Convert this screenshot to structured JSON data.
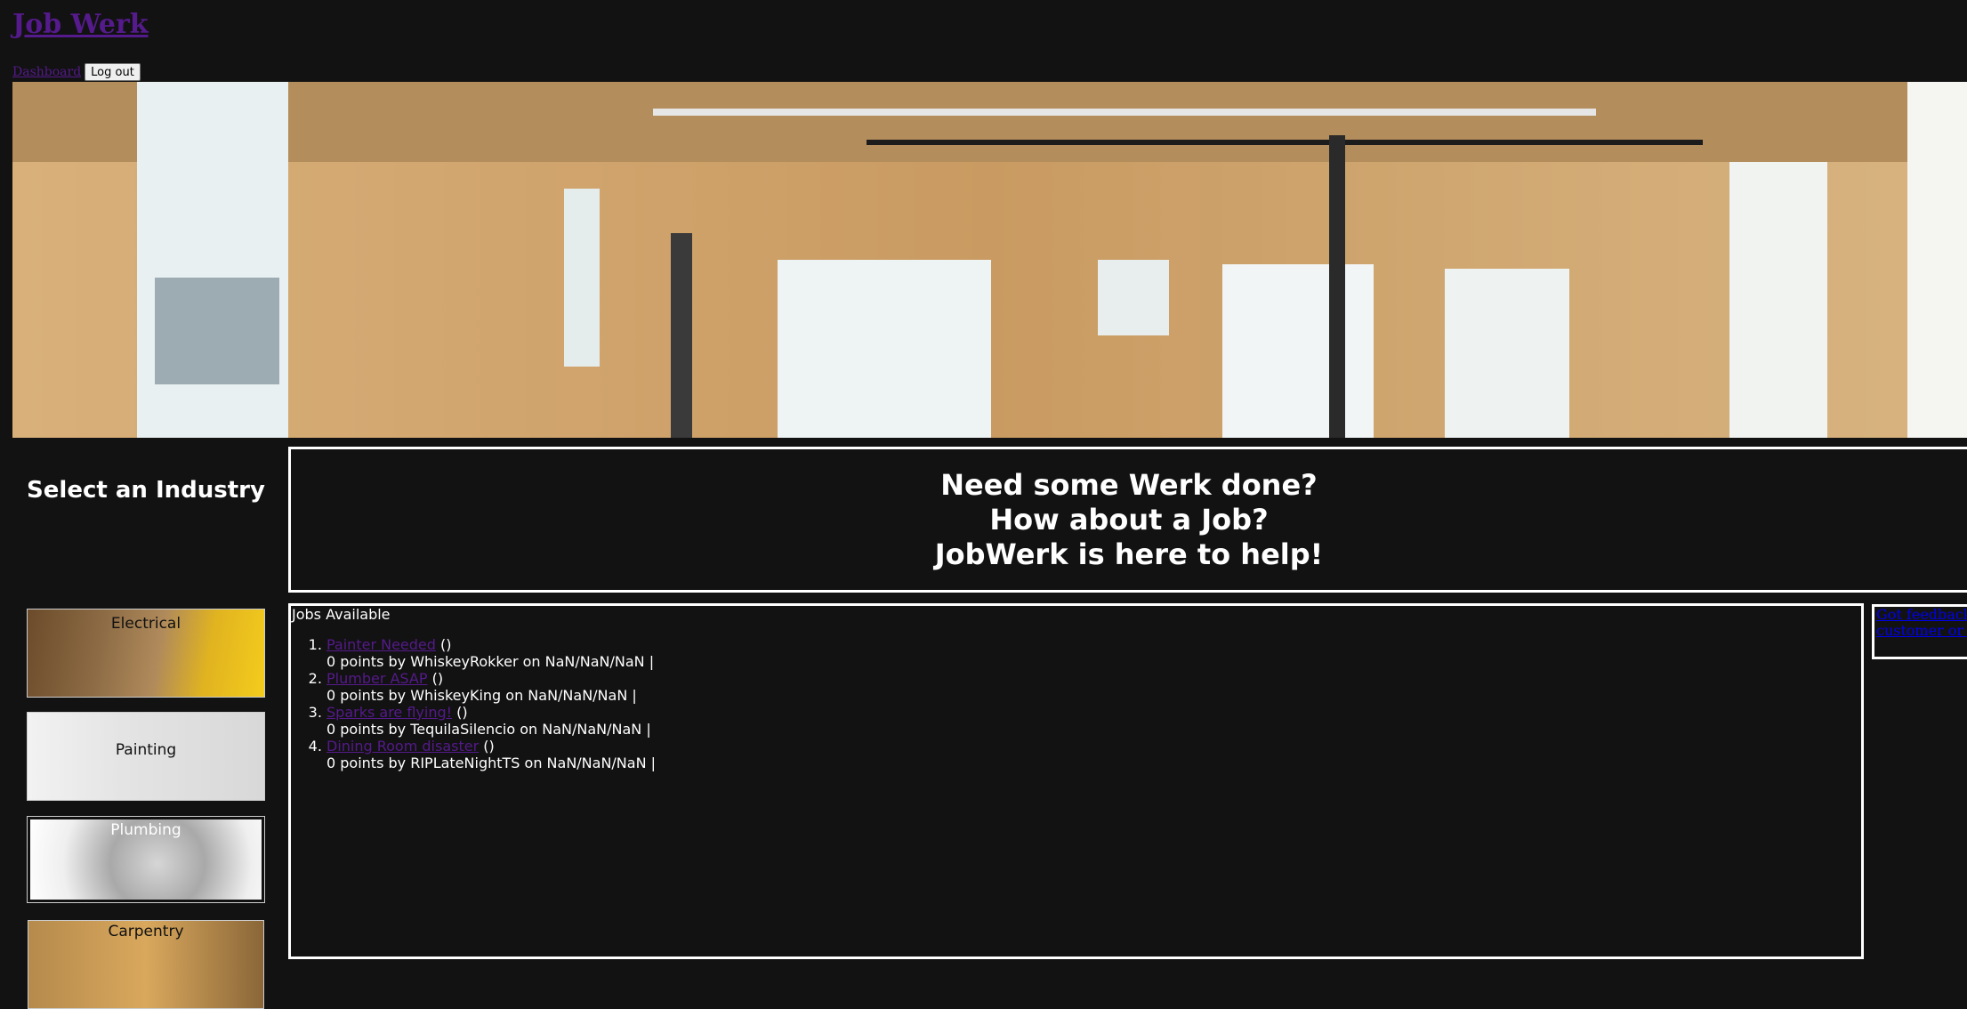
{
  "site": {
    "title": "Job Werk"
  },
  "nav": {
    "dashboard_label": "Dashboard",
    "logout_label": "Log out"
  },
  "hero_image": {
    "alt": "interior of house under construction with wood framing"
  },
  "sidebar": {
    "title": "Select an Industry",
    "industries": [
      {
        "label": "Electrical"
      },
      {
        "label": "Painting"
      },
      {
        "label": "Plumbing"
      },
      {
        "label": "Carpentry"
      }
    ]
  },
  "hero_message": {
    "line1": "Need some Werk done?",
    "line2": "How about a Job?",
    "line3": "JobWerk is here to help!"
  },
  "jobs": {
    "heading": "Jobs Available",
    "items": [
      {
        "title": "Painter Needed",
        "suffix": " ()",
        "byline": "0 points by WhiskeyRokker on NaN/NaN/NaN |"
      },
      {
        "title": "Plumber ASAP",
        "suffix": " ()",
        "byline": "0 points by WhiskeyKing on NaN/NaN/NaN |"
      },
      {
        "title": "Sparks are flying!",
        "suffix": " ()",
        "byline": "0 points by TequilaSilencio on NaN/NaN/NaN |"
      },
      {
        "title": "Dining Room disaster",
        "suffix": " ()",
        "byline": "0 points by RIPLateNightTS on NaN/NaN/NaN |"
      }
    ]
  },
  "feedback": {
    "link_text": "Got feedback for a customer or worker?"
  },
  "colors": {
    "background": "#121212",
    "visited_link": "#551a8b",
    "link": "#0000ee",
    "text": "#ffffff"
  }
}
